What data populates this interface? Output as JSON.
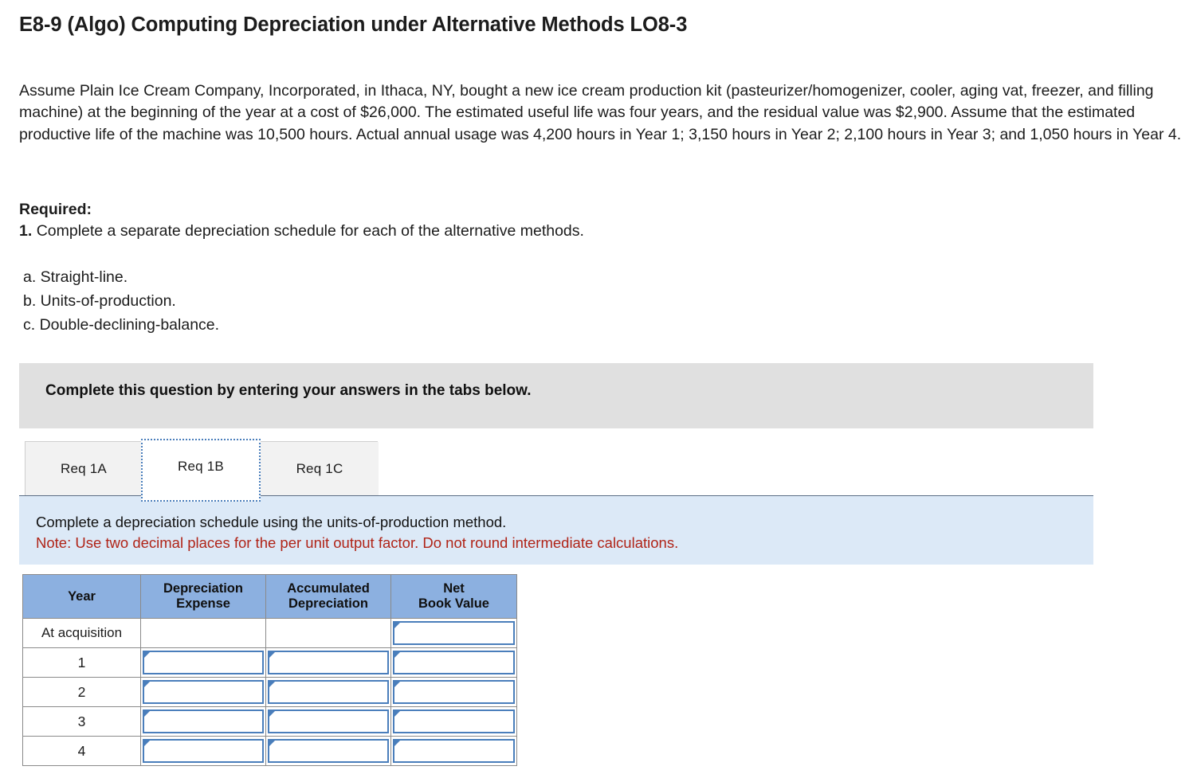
{
  "page": {
    "title": "E8-9 (Algo) Computing Depreciation under Alternative Methods LO8-3",
    "problem_text": "Assume Plain Ice Cream Company, Incorporated, in Ithaca, NY, bought a new ice cream production kit (pasteurizer/homogenizer, cooler, aging vat, freezer, and filling machine) at the beginning of the year at a cost of $26,000. The estimated useful life was four years, and the residual value was $2,900. Assume that the estimated productive life of the machine was 10,500 hours. Actual annual usage was 4,200 hours in Year 1; 3,150 hours in Year 2; 2,100 hours in Year 3; and 1,050 hours in Year 4."
  },
  "required": {
    "label": "Required:",
    "item_number": "1.",
    "item_text": "Complete a separate depreciation schedule for each of the alternative methods.",
    "methods": [
      "a. Straight-line.",
      "b. Units-of-production.",
      "c. Double-declining-balance."
    ]
  },
  "banner": {
    "text": "Complete this question by entering your answers in the tabs below."
  },
  "tabs": {
    "items": [
      {
        "label": "Req 1A",
        "active": false
      },
      {
        "label": "Req 1B",
        "active": true
      },
      {
        "label": "Req 1C",
        "active": false
      }
    ]
  },
  "instruction_panel": {
    "line1": "Complete a depreciation schedule using the units-of-production method.",
    "line2": "Note: Use two decimal places for the per unit output factor. Do not round intermediate calculations."
  },
  "table": {
    "headers": [
      "Year",
      "Depreciation Expense",
      "Accumulated Depreciation",
      "Net Book Value"
    ],
    "header_lines": [
      [
        "Year"
      ],
      [
        "Depreciation",
        "Expense"
      ],
      [
        "Accumulated",
        "Depreciation"
      ],
      [
        "Net",
        "Book Value"
      ]
    ],
    "rows": [
      {
        "year": "At acquisition",
        "depreciation_expense": "",
        "accumulated_depreciation": "",
        "net_book_value": ""
      },
      {
        "year": "1",
        "depreciation_expense": "",
        "accumulated_depreciation": "",
        "net_book_value": ""
      },
      {
        "year": "2",
        "depreciation_expense": "",
        "accumulated_depreciation": "",
        "net_book_value": ""
      },
      {
        "year": "3",
        "depreciation_expense": "",
        "accumulated_depreciation": "",
        "net_book_value": ""
      },
      {
        "year": "4",
        "depreciation_expense": "",
        "accumulated_depreciation": "",
        "net_book_value": ""
      }
    ]
  },
  "colors": {
    "header_blue": "#8cb0e0",
    "panel_blue": "#dce9f7",
    "banner_gray": "#e0e0e0",
    "note_red": "#b02418",
    "input_border_blue": "#4a7ebb"
  }
}
